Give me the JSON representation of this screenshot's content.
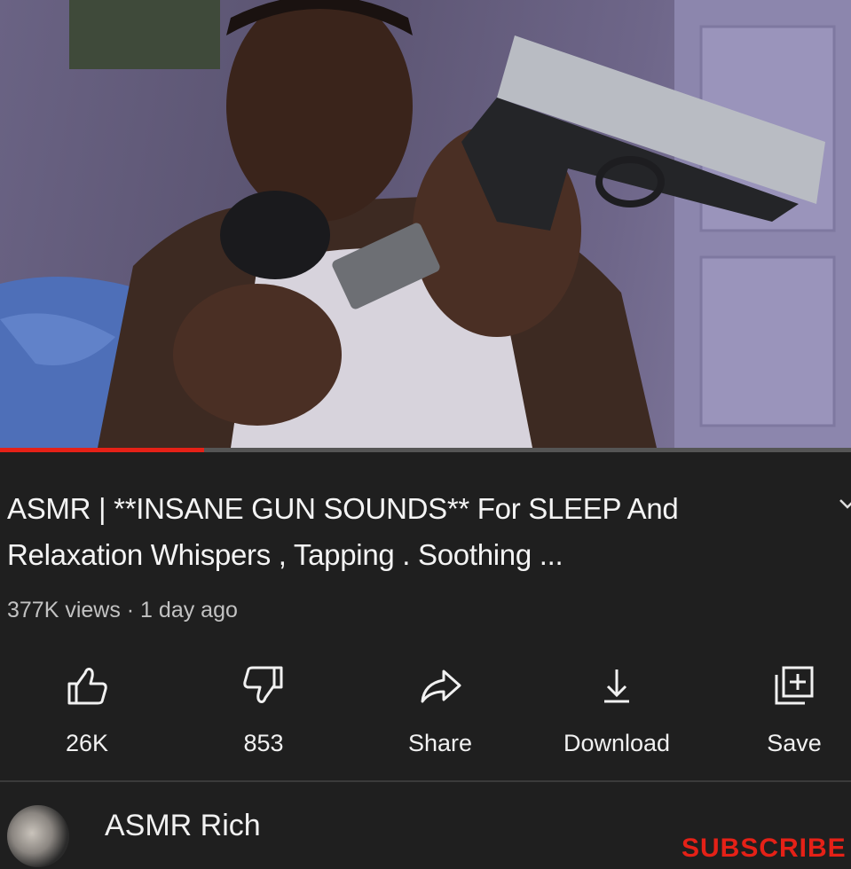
{
  "video": {
    "progress_fraction": 0.24
  },
  "title": "ASMR | **INSANE GUN SOUNDS**  For SLEEP And Relaxation Whispers , Tapping . Soothing ...",
  "meta": "377K views · 1 day ago",
  "actions": [
    {
      "label": "26K",
      "icon": "thumbs-up-icon"
    },
    {
      "label": "853",
      "icon": "thumbs-down-icon"
    },
    {
      "label": "Share",
      "icon": "share-icon"
    },
    {
      "label": "Download",
      "icon": "download-icon"
    },
    {
      "label": "Save",
      "icon": "save-playlist-icon"
    }
  ],
  "channel": {
    "name": "ASMR Rich",
    "subscribe_label": "SUBSCRIBE"
  },
  "colors": {
    "background": "#1f1f1f",
    "accent_red": "#e52117",
    "text": "#f1f1f1",
    "muted_text": "#c2c2c2"
  }
}
